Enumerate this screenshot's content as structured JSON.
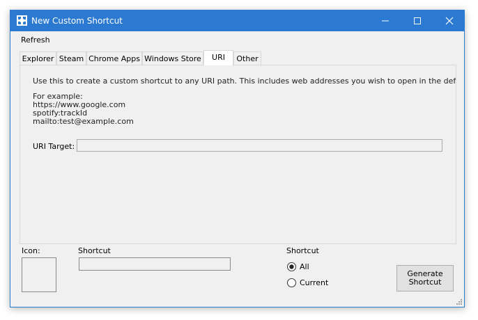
{
  "window": {
    "title": "New Custom Shortcut",
    "titlebar_color": "#2b79d0",
    "buttons": [
      "minimize",
      "maximize",
      "close"
    ]
  },
  "menu": {
    "refresh": "Refresh"
  },
  "tabs": [
    {
      "label": "Explorer"
    },
    {
      "label": "Steam"
    },
    {
      "label": "Chrome Apps"
    },
    {
      "label": "Windows Store"
    },
    {
      "label": "URI",
      "selected": true
    },
    {
      "label": "Other"
    }
  ],
  "uri_tab": {
    "description": "Use this to create a custom shortcut to any URI path. This includes web addresses you wish to open in the default br",
    "examples_heading": "For example:",
    "examples": [
      "https://www.google.com",
      "spotify:trackId",
      "mailto:test@example.com"
    ],
    "uri_target_label": "URI Target:",
    "uri_target_value": ""
  },
  "bottom": {
    "icon_label": "Icon:",
    "shortcut_label": "Shortcut",
    "shortcut_value": "",
    "group_label": "Shortcut",
    "radio_all": "All",
    "radio_current": "Current",
    "selected_radio": "All",
    "generate_line1": "Generate",
    "generate_line2": "Shortcut"
  }
}
